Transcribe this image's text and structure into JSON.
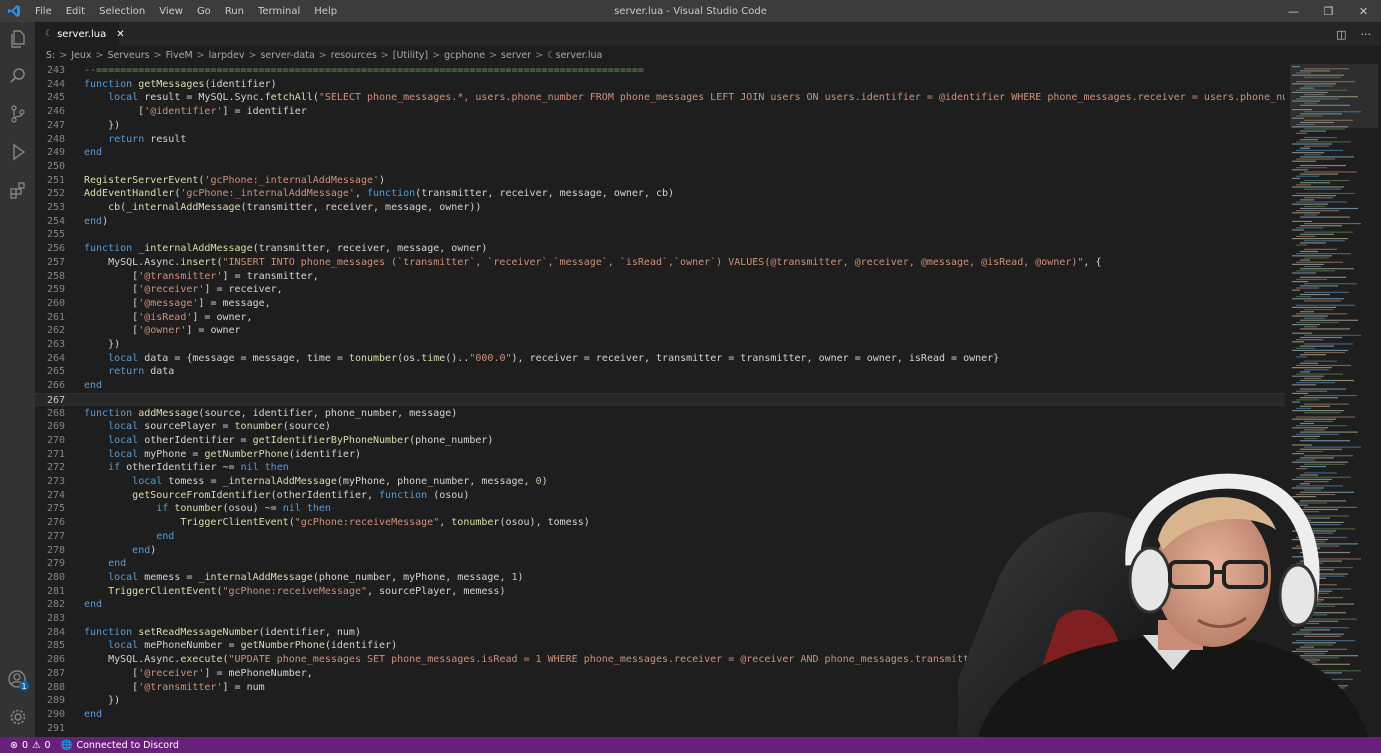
{
  "app": {
    "window_title": "server.lua - Visual Studio Code",
    "menu": [
      "File",
      "Edit",
      "Selection",
      "View",
      "Go",
      "Run",
      "Terminal",
      "Help"
    ]
  },
  "tab": {
    "label": "server.lua"
  },
  "breadcrumb": [
    "S:",
    "Jeux",
    "Serveurs",
    "FiveM",
    "larpdev",
    "server-data",
    "resources",
    "[Utility]",
    "gcphone",
    "server",
    "server.lua"
  ],
  "editor": {
    "lines": [
      {
        "n": "243",
        "t": "--==========================================================================================="
      },
      {
        "n": "244",
        "t": "function getMessages(identifier)"
      },
      {
        "n": "245",
        "t": "    local result = MySQL.Sync.fetchAll(\"SELECT phone_messages.*, users.phone_number FROM phone_messages LEFT JOIN users ON users.identifier = @identifier WHERE phone_messages.receiver = users.phone_number\", {"
      },
      {
        "n": "246",
        "t": "         ['@identifier'] = identifier"
      },
      {
        "n": "247",
        "t": "    })"
      },
      {
        "n": "248",
        "t": "    return result"
      },
      {
        "n": "249",
        "t": "end"
      },
      {
        "n": "250",
        "t": ""
      },
      {
        "n": "251",
        "t": "RegisterServerEvent('gcPhone:_internalAddMessage')"
      },
      {
        "n": "252",
        "t": "AddEventHandler('gcPhone:_internalAddMessage', function(transmitter, receiver, message, owner, cb)"
      },
      {
        "n": "253",
        "t": "    cb(_internalAddMessage(transmitter, receiver, message, owner))"
      },
      {
        "n": "254",
        "t": "end)"
      },
      {
        "n": "255",
        "t": ""
      },
      {
        "n": "256",
        "t": "function _internalAddMessage(transmitter, receiver, message, owner)"
      },
      {
        "n": "257",
        "t": "    MySQL.Async.insert(\"INSERT INTO phone_messages (`transmitter`, `receiver`,`message`, `isRead`,`owner`) VALUES(@transmitter, @receiver, @message, @isRead, @owner)\", {"
      },
      {
        "n": "258",
        "t": "        ['@transmitter'] = transmitter,"
      },
      {
        "n": "259",
        "t": "        ['@receiver'] = receiver,"
      },
      {
        "n": "260",
        "t": "        ['@message'] = message,"
      },
      {
        "n": "261",
        "t": "        ['@isRead'] = owner,"
      },
      {
        "n": "262",
        "t": "        ['@owner'] = owner"
      },
      {
        "n": "263",
        "t": "    })"
      },
      {
        "n": "264",
        "t": "    local data = {message = message, time = tonumber(os.time()..\"000.0\"), receiver = receiver, transmitter = transmitter, owner = owner, isRead = owner}"
      },
      {
        "n": "265",
        "t": "    return data"
      },
      {
        "n": "266",
        "t": "end"
      },
      {
        "n": "267",
        "t": ""
      },
      {
        "n": "268",
        "t": "function addMessage(source, identifier, phone_number, message)"
      },
      {
        "n": "269",
        "t": "    local sourcePlayer = tonumber(source)"
      },
      {
        "n": "270",
        "t": "    local otherIdentifier = getIdentifierByPhoneNumber(phone_number)"
      },
      {
        "n": "271",
        "t": "    local myPhone = getNumberPhone(identifier)"
      },
      {
        "n": "272",
        "t": "    if otherIdentifier ~= nil then"
      },
      {
        "n": "273",
        "t": "        local tomess = _internalAddMessage(myPhone, phone_number, message, 0)"
      },
      {
        "n": "274",
        "t": "        getSourceFromIdentifier(otherIdentifier, function (osou)"
      },
      {
        "n": "275",
        "t": "            if tonumber(osou) ~= nil then"
      },
      {
        "n": "276",
        "t": "                TriggerClientEvent(\"gcPhone:receiveMessage\", tonumber(osou), tomess)"
      },
      {
        "n": "277",
        "t": "            end"
      },
      {
        "n": "278",
        "t": "        end)"
      },
      {
        "n": "279",
        "t": "    end"
      },
      {
        "n": "280",
        "t": "    local memess = _internalAddMessage(phone_number, myPhone, message, 1)"
      },
      {
        "n": "281",
        "t": "    TriggerClientEvent(\"gcPhone:receiveMessage\", sourcePlayer, memess)"
      },
      {
        "n": "282",
        "t": "end"
      },
      {
        "n": "283",
        "t": ""
      },
      {
        "n": "284",
        "t": "function setReadMessageNumber(identifier, num)"
      },
      {
        "n": "285",
        "t": "    local mePhoneNumber = getNumberPhone(identifier)"
      },
      {
        "n": "286",
        "t": "    MySQL.Async.execute(\"UPDATE phone_messages SET phone_messages.isRead = 1 WHERE phone_messages.receiver = @receiver AND phone_messages.transmitter = @transmitte"
      },
      {
        "n": "287",
        "t": "        ['@receiver'] = mePhoneNumber,"
      },
      {
        "n": "288",
        "t": "        ['@transmitter'] = num"
      },
      {
        "n": "289",
        "t": "    })"
      },
      {
        "n": "290",
        "t": "end"
      },
      {
        "n": "291",
        "t": ""
      }
    ],
    "current_line": "267"
  },
  "status": {
    "errors": "0",
    "warnings": "0",
    "discord": "Connected to Discord"
  },
  "account_badge": "1",
  "colors": {
    "status_bar": "#68217a",
    "keyword": "#569cd6",
    "string": "#ce9178",
    "function": "#dcdcaa",
    "variable": "#9cdcfe",
    "number": "#b5cea8",
    "comment": "#6a9955"
  }
}
